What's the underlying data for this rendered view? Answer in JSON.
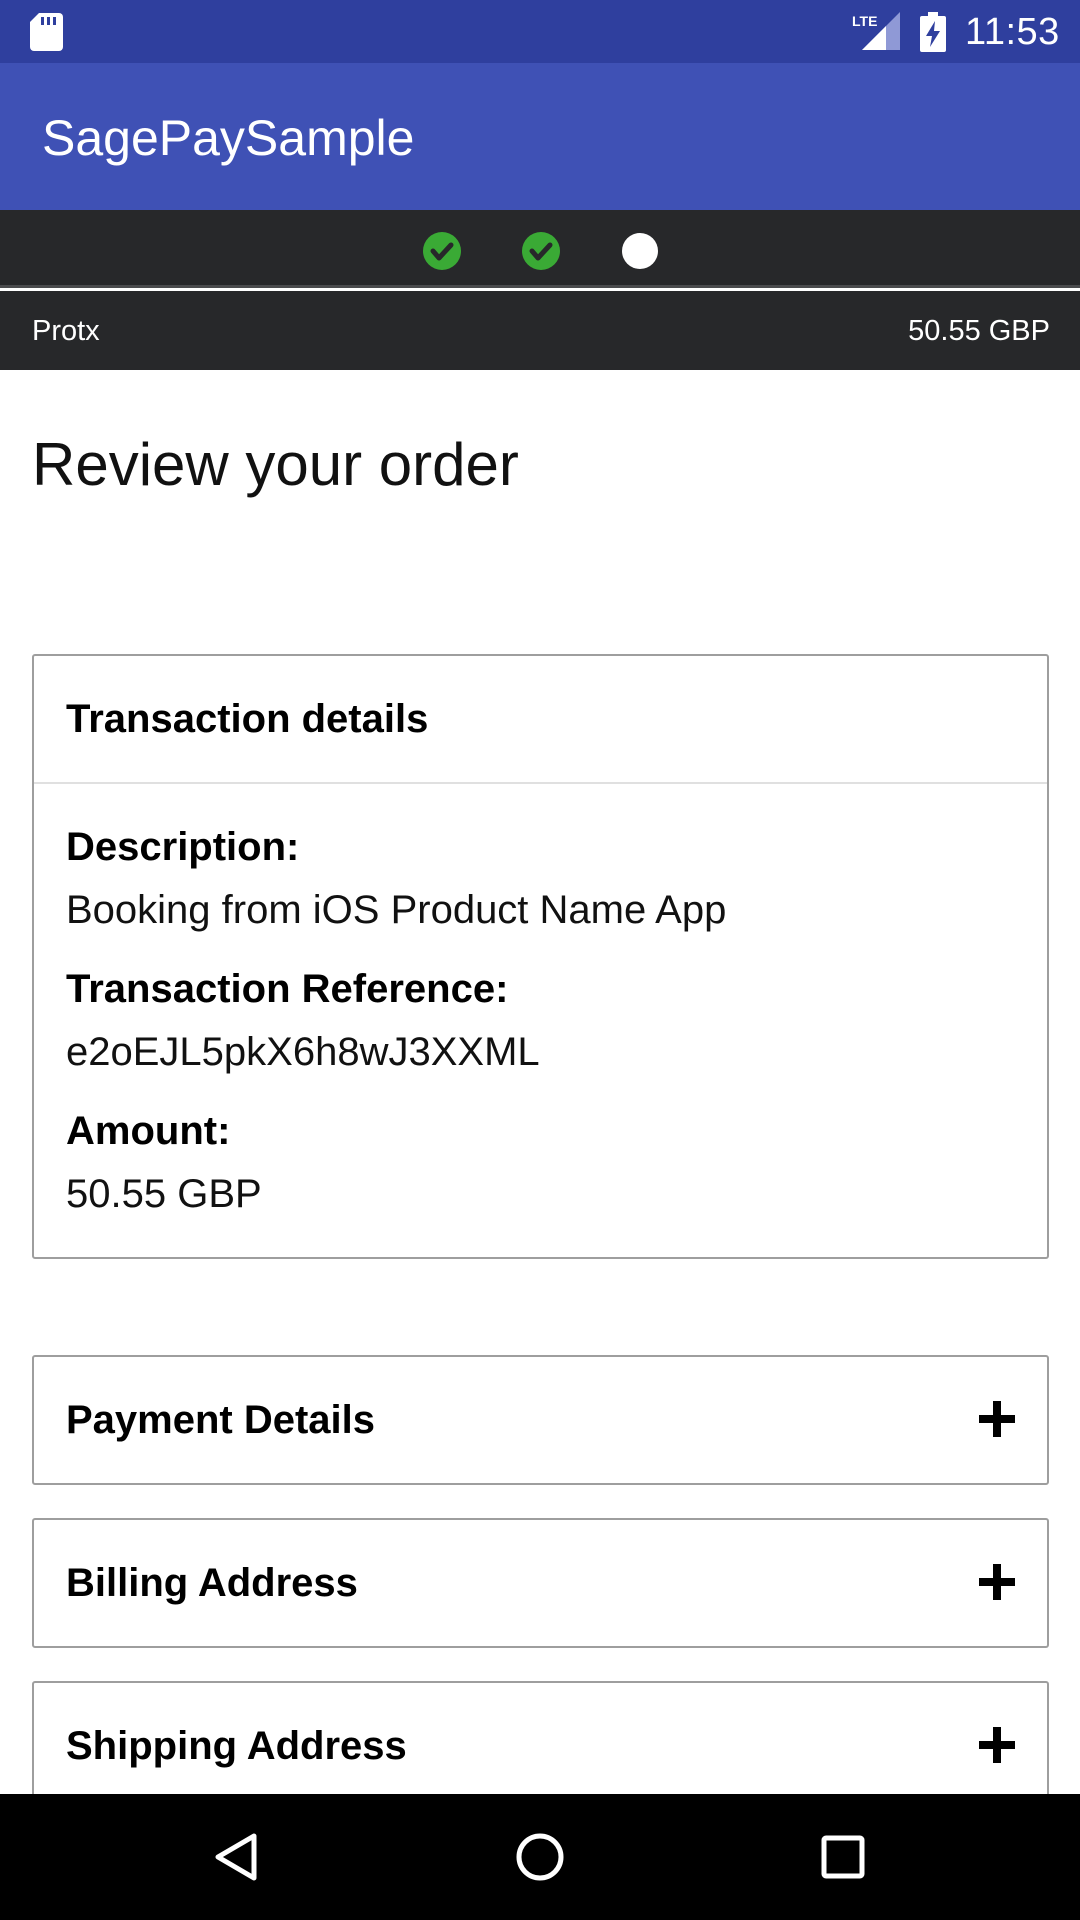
{
  "status_bar": {
    "time": "11:53",
    "network": "LTE",
    "icons": [
      "sd-card-icon",
      "lte-signal-icon",
      "battery-charging-icon"
    ]
  },
  "app_bar": {
    "title": "SagePaySample"
  },
  "steps": [
    {
      "state": "complete",
      "icon": "check-circle-icon"
    },
    {
      "state": "complete",
      "icon": "check-circle-icon"
    },
    {
      "state": "current",
      "icon": "dot-icon"
    }
  ],
  "merchant": {
    "name": "Protx",
    "amount": "50.55 GBP"
  },
  "page": {
    "title": "Review your order"
  },
  "transaction": {
    "title": "Transaction details",
    "description_label": "Description:",
    "description_value": "Booking from iOS Product Name App",
    "reference_label": "Transaction Reference:",
    "reference_value": "e2oEJL5pkX6h8wJ3XXML",
    "amount_label": "Amount:",
    "amount_value": "50.55 GBP"
  },
  "sections": [
    {
      "title": "Payment Details",
      "icon": "plus-icon"
    },
    {
      "title": "Billing Address",
      "icon": "plus-icon"
    },
    {
      "title": "Shipping Address",
      "icon": "plus-icon"
    }
  ],
  "colors": {
    "status_bar": "#2f3f9e",
    "app_bar": "#3f51b5",
    "dark_bar": "#27282a",
    "step_complete": "#3aaa35"
  }
}
